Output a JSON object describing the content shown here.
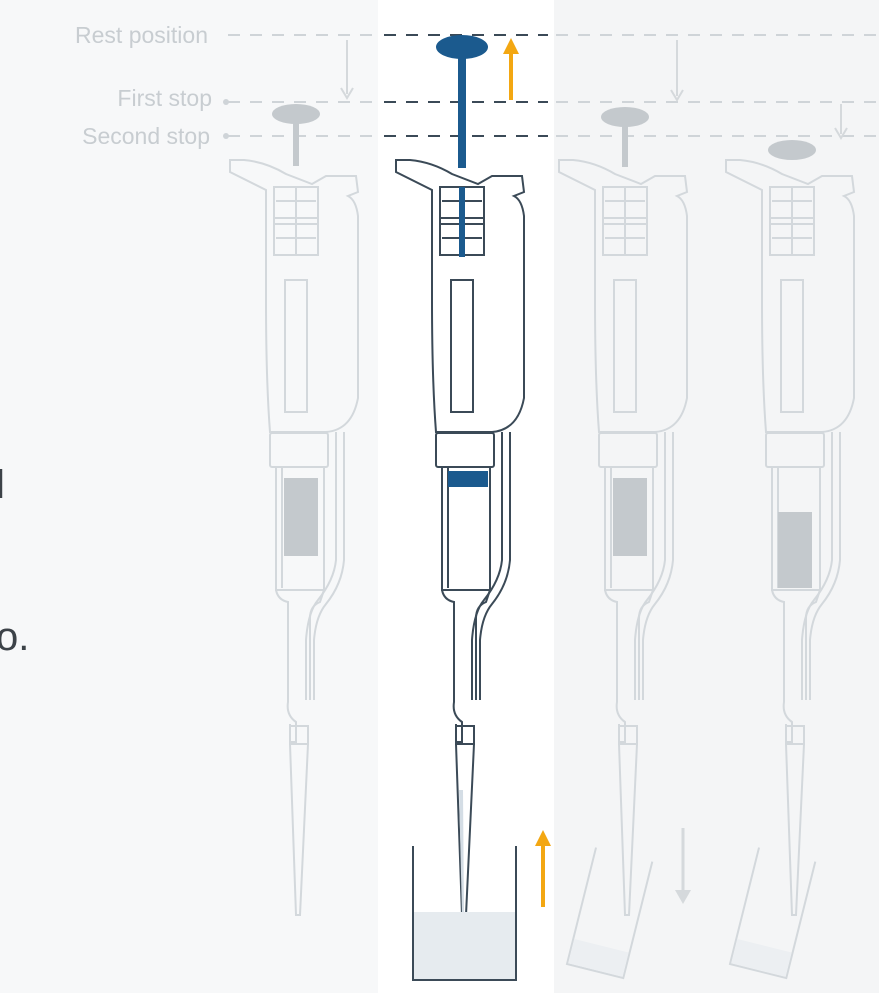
{
  "labels": {
    "rest_position": "Rest position",
    "first_stop": "First stop",
    "second_stop": "Second stop"
  },
  "cropped_text": [
    "l",
    "o."
  ],
  "colors": {
    "faded": "#cdd3d7",
    "active_outline": "#3b4a57",
    "plunger_blue": "#1b5a8e",
    "arrow_orange": "#f3a712",
    "arrow_gray": "#d5d9dc",
    "liquid_gray": "#c4c9cd",
    "liquid_light": "#e3e8ec",
    "label_text": "#c8cdd1",
    "page_text": "#3c4248"
  },
  "icons": {
    "pipette": "pipette-icon",
    "beaker": "beaker-icon",
    "tube": "tube-icon",
    "up_arrow": "up-arrow-icon",
    "down_arrow": "down-arrow-icon"
  }
}
